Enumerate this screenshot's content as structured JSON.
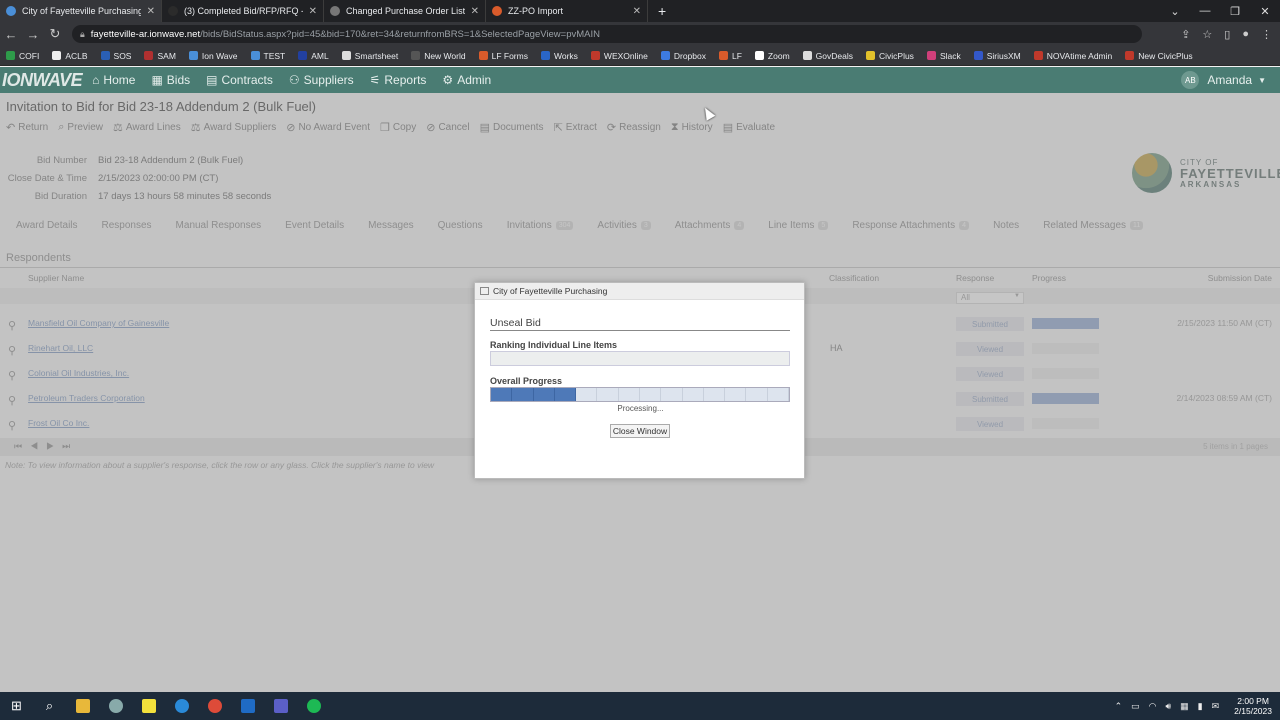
{
  "browser": {
    "tabs": [
      {
        "title": "City of Fayetteville Purchasing",
        "icon": "lines-icon",
        "color": "#4a8fd8",
        "active": true
      },
      {
        "title": "(3) Completed Bid/RFP/RFQ - Sm",
        "icon": "v-icon",
        "color": "#2b2b2b",
        "active": false
      },
      {
        "title": "Changed Purchase Order List",
        "icon": "globe-icon",
        "color": "#777777",
        "active": false
      },
      {
        "title": "ZZ-PO Import",
        "icon": "laserfiche-icon",
        "color": "#d95b2b",
        "active": false
      }
    ],
    "url_host": "fayetteville-ar.ionwave.net",
    "url_path": "/bids/BidStatus.aspx?pid=45&bid=170&ret=34&returnfromBRS=1&SelectedPageView=pvMAIN",
    "bookmarks": [
      {
        "label": "COFI",
        "color": "#2e9b4a"
      },
      {
        "label": "ACLB",
        "color": "#eeeeee"
      },
      {
        "label": "SOS",
        "color": "#2a5fb5"
      },
      {
        "label": "SAM",
        "color": "#b03030"
      },
      {
        "label": "Ion Wave",
        "color": "#4a8fd8"
      },
      {
        "label": "TEST",
        "color": "#4a8fd8"
      },
      {
        "label": "AML",
        "color": "#2240a0"
      },
      {
        "label": "Smartsheet",
        "color": "#dddddd"
      },
      {
        "label": "New World",
        "color": "#555555"
      },
      {
        "label": "LF Forms",
        "color": "#d95b2b"
      },
      {
        "label": "Works",
        "color": "#2a66c8"
      },
      {
        "label": "WEXOnline",
        "color": "#c0392b"
      },
      {
        "label": "Dropbox",
        "color": "#3d7be0"
      },
      {
        "label": "LF",
        "color": "#d95b2b"
      },
      {
        "label": "Zoom",
        "color": "#ffffff"
      },
      {
        "label": "GovDeals",
        "color": "#dddddd"
      },
      {
        "label": "CivicPlus",
        "color": "#e2c12b"
      },
      {
        "label": "Slack",
        "color": "#cf3f7a"
      },
      {
        "label": "SiriusXM",
        "color": "#3358c9"
      },
      {
        "label": "NOVAtime Admin",
        "color": "#c0392b"
      },
      {
        "label": "New CivicPlus",
        "color": "#c0392b"
      }
    ]
  },
  "app": {
    "logo": "IONWAVE",
    "menu": [
      {
        "label": "Home",
        "icon": "home-icon"
      },
      {
        "label": "Bids",
        "icon": "bids-icon"
      },
      {
        "label": "Contracts",
        "icon": "contracts-icon"
      },
      {
        "label": "Suppliers",
        "icon": "suppliers-icon"
      },
      {
        "label": "Reports",
        "icon": "reports-icon"
      },
      {
        "label": "Admin",
        "icon": "gear-icon"
      }
    ],
    "user_initials": "AB",
    "user_name": "Amanda"
  },
  "page": {
    "title": "Invitation to Bid for Bid 23-18 Addendum 2 (Bulk Fuel)",
    "toolbar": [
      "Return",
      "Preview",
      "Award Lines",
      "Award Suppliers",
      "No Award Event",
      "Copy",
      "Cancel",
      "Documents",
      "Extract",
      "Reassign",
      "History",
      "Evaluate"
    ],
    "meta": [
      {
        "label": "Bid Number",
        "value": "Bid 23-18 Addendum 2 (Bulk Fuel)"
      },
      {
        "label": "Close Date & Time",
        "value": "2/15/2023 02:00:00 PM (CT)"
      },
      {
        "label": "Bid Duration",
        "value": "17 days 13 hours 58 minutes 58 seconds"
      }
    ],
    "city_logo": {
      "line1": "CITY OF",
      "line2": "FAYETTEVILLE",
      "line3": "ARKANSAS"
    },
    "subtabs": [
      {
        "label": "Award Details",
        "badge": ""
      },
      {
        "label": "Responses",
        "badge": ""
      },
      {
        "label": "Manual Responses",
        "badge": ""
      },
      {
        "label": "Event Details",
        "badge": ""
      },
      {
        "label": "Messages",
        "badge": ""
      },
      {
        "label": "Questions",
        "badge": ""
      },
      {
        "label": "Invitations",
        "badge": "304"
      },
      {
        "label": "Activities",
        "badge": "3"
      },
      {
        "label": "Attachments",
        "badge": "4"
      },
      {
        "label": "Line Items",
        "badge": "5"
      },
      {
        "label": "Response Attachments",
        "badge": "4"
      },
      {
        "label": "Notes",
        "badge": ""
      },
      {
        "label": "Related Messages",
        "badge": "11"
      }
    ],
    "section_title": "Respondents",
    "columns": {
      "supplier": "Supplier Name",
      "classification": "Classification",
      "response": "Response",
      "progress": "Progress",
      "submission": "Submission Date"
    },
    "filter_value": "All",
    "rows": [
      {
        "supplier": "Mansfield Oil Company of Gainesville",
        "classification": "",
        "response": "Submitted",
        "progress": 1.0,
        "submission": "2/15/2023 11:50 AM (CT)"
      },
      {
        "supplier": "Rinehart Oil, LLC",
        "classification": "HA",
        "response": "Viewed",
        "progress": 0.0,
        "submission": ""
      },
      {
        "supplier": "Colonial Oil Industries, Inc.",
        "classification": "",
        "response": "Viewed",
        "progress": 0.0,
        "submission": ""
      },
      {
        "supplier": "Petroleum Traders Corporation",
        "classification": "",
        "response": "Submitted",
        "progress": 1.0,
        "submission": "2/14/2023 08:59 AM (CT)"
      },
      {
        "supplier": "Frost Oil Co Inc.",
        "classification": "",
        "response": "Viewed",
        "progress": 0.0,
        "submission": ""
      }
    ],
    "pager_count": "5 items in 1 pages",
    "note": "Note: To view information about a supplier's response, click the row or any glass. Click the supplier's name to view"
  },
  "dialog": {
    "window_title": "City of Fayetteville Purchasing",
    "heading": "Unseal Bid",
    "label1": "Ranking Individual Line Items",
    "label2": "Overall Progress",
    "overall_progress_segments": 14,
    "overall_progress_done": 4,
    "status": "Processing...",
    "close_label": "Close Window"
  },
  "taskbar": {
    "time": "2:00 PM",
    "date": "2/15/2023"
  }
}
